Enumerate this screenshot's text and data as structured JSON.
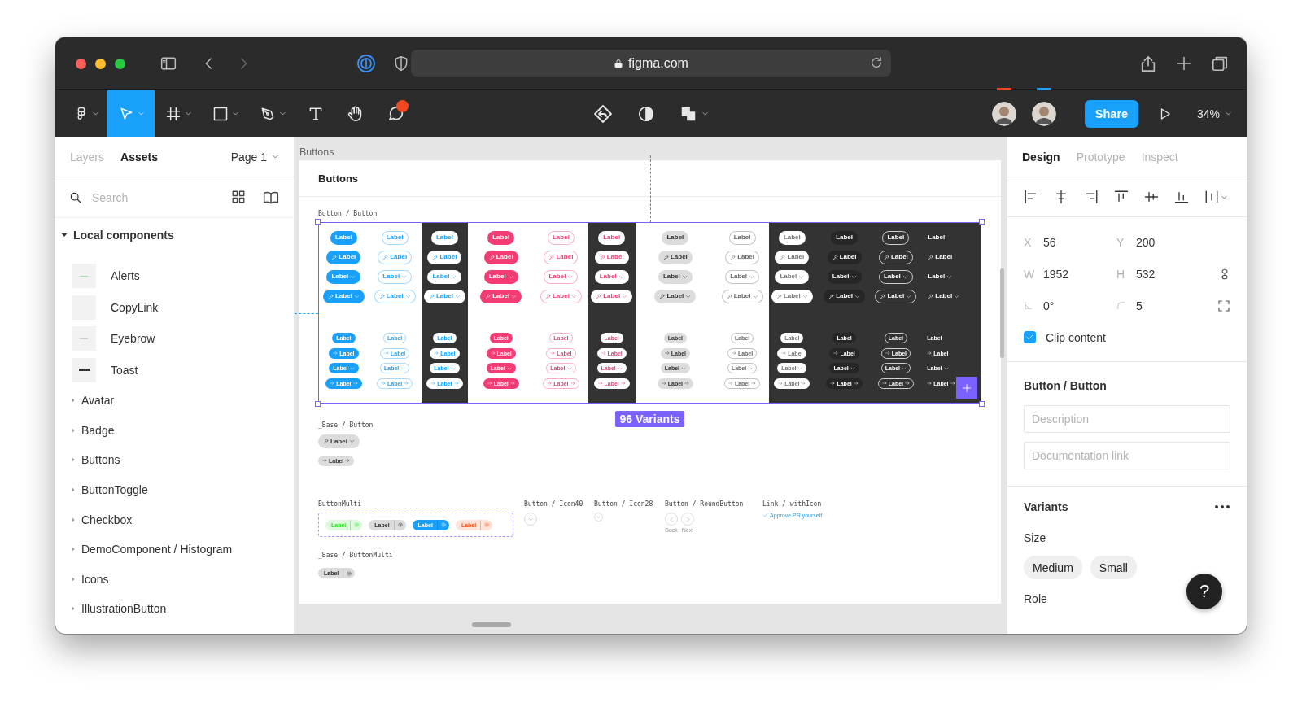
{
  "browser": {
    "url": "figma.com"
  },
  "toolbar": {
    "tools": [
      {
        "kind": "logo",
        "selected": false,
        "notification": false
      },
      {
        "kind": "move",
        "selected": true,
        "notification": false
      },
      {
        "kind": "frame",
        "selected": false,
        "notification": false
      },
      {
        "kind": "shape",
        "selected": false,
        "notification": false
      },
      {
        "kind": "pen",
        "selected": false,
        "notification": false
      },
      {
        "kind": "text",
        "selected": false,
        "notification": false
      },
      {
        "kind": "hand",
        "selected": false,
        "notification": false
      },
      {
        "kind": "comment",
        "selected": false,
        "notification": true
      }
    ],
    "collaborators": [
      {
        "color": "#f24822"
      },
      {
        "color": "#18a0fb"
      }
    ],
    "share": "Share",
    "zoom": "34%"
  },
  "left_panel": {
    "tabs": [
      {
        "label": "Layers",
        "selected": false
      },
      {
        "label": "Assets",
        "selected": true
      }
    ],
    "page": "Page 1",
    "search": {
      "placeholder": "Search"
    },
    "section": {
      "title": "Local components",
      "expanded": true
    },
    "components": [
      {
        "name": "Alerts",
        "kind": "alert"
      },
      {
        "name": "CopyLink",
        "kind": "blank"
      },
      {
        "name": "Eyebrow",
        "kind": "rule"
      },
      {
        "name": "Toast",
        "kind": "bar"
      }
    ],
    "groups": [
      {
        "name": "Avatar",
        "expanded": false
      },
      {
        "name": "Badge",
        "expanded": false
      },
      {
        "name": "Buttons",
        "expanded": false
      },
      {
        "name": "ButtonToggle",
        "expanded": false
      },
      {
        "name": "Checkbox",
        "expanded": false
      },
      {
        "name": "DemoComponent / Histogram",
        "expanded": false
      },
      {
        "name": "Icons",
        "expanded": false
      },
      {
        "name": "IllustrationButton",
        "expanded": false
      }
    ]
  },
  "canvas": {
    "frame_label": "Buttons",
    "frame_title": "Buttons",
    "variant_set": {
      "label": "Button / Button",
      "count": "96 Variants",
      "columns": [
        {
          "kind": "filled",
          "color": "#18a0fb",
          "labels": [
            "Label",
            "Label",
            "Label",
            "Label",
            "Label",
            "Label",
            "Label",
            "Label"
          ]
        },
        {
          "kind": "outline",
          "color": "#18a0fb",
          "labels": [
            "Label",
            "Label",
            "Label",
            "Label",
            "Label",
            "Label",
            "Label",
            "Label"
          ]
        },
        {
          "kind": "inverse",
          "color": "#18a0fb",
          "labels": [
            "Label",
            "Label",
            "Label",
            "Label",
            "Label",
            "Label",
            "Label",
            "Label"
          ]
        },
        {
          "kind": "filled",
          "color": "#f23c73",
          "labels": [
            "Label",
            "Label",
            "Label",
            "Label",
            "Label",
            "Label",
            "Label",
            "Label"
          ]
        },
        {
          "kind": "outline",
          "color": "#f23c73",
          "labels": [
            "Label",
            "Label",
            "Label",
            "Label",
            "Label",
            "Label",
            "Label",
            "Label"
          ]
        },
        {
          "kind": "inverse",
          "color": "#f23c73",
          "labels": [
            "Label",
            "Label",
            "Label",
            "Label",
            "Label",
            "Label",
            "Label",
            "Label"
          ]
        },
        {
          "kind": "filled",
          "color": "#dcdcdc",
          "labels": [
            "Label",
            "Label",
            "Label",
            "Label",
            "Label",
            "Label",
            "Label",
            "Label"
          ]
        },
        {
          "kind": "outline",
          "color": "#666666",
          "labels": [
            "Label",
            "Label",
            "Label",
            "Label",
            "Label",
            "Label",
            "Label",
            "Label"
          ]
        },
        {
          "kind": "inverse",
          "color": "#777777",
          "labels": [
            "Label",
            "Label",
            "Label",
            "Label",
            "Label",
            "Label",
            "Label",
            "Label"
          ]
        },
        {
          "kind": "subtle",
          "color": "#ffffff",
          "labels": [
            "Label",
            "Label",
            "Label",
            "Label",
            "Label",
            "Label",
            "Label",
            "Label"
          ]
        },
        {
          "kind": "outlined",
          "color": "#ffffff",
          "labels": [
            "Label",
            "Label",
            "Label",
            "Label",
            "Label",
            "Label",
            "Label",
            "Label"
          ]
        },
        {
          "kind": "text",
          "color": "#ffffff",
          "labels": [
            "Label",
            "Label",
            "Label",
            "Label",
            "Label",
            "Label",
            "Label",
            "Label"
          ]
        }
      ]
    },
    "base_button": {
      "label": "_Base / Button",
      "buttons": [
        {
          "label": "Label"
        },
        {
          "label": "Label"
        }
      ]
    },
    "button_multi": {
      "label": "ButtonMulti",
      "buttons": [
        {
          "color": "#dcfadb",
          "label": "Label"
        },
        {
          "color": "#dcdcdc",
          "label": "Label"
        },
        {
          "color": "#18a0fb",
          "label": "Label"
        },
        {
          "color": "#ffe2d8",
          "label": "Label"
        }
      ]
    },
    "icon40": {
      "label": "Button / Icon40"
    },
    "icon28": {
      "label": "Button / Icon28"
    },
    "round_button": {
      "label": "Button / RoundButton",
      "buttons": [
        {
          "kind": "back",
          "caption": "Back"
        },
        {
          "kind": "next",
          "caption": "Next"
        }
      ]
    },
    "link": {
      "label": "Link / withIcon",
      "text": "Approve PR yourself"
    },
    "base_multi": {
      "label": "_Base / ButtonMulti",
      "button": {
        "color": "#dcdcdc",
        "label": "Label"
      }
    }
  },
  "design_panel": {
    "tabs": [
      {
        "label": "Design",
        "selected": true
      },
      {
        "label": "Prototype",
        "selected": false
      },
      {
        "label": "Inspect",
        "selected": false
      }
    ],
    "geometry": [
      {
        "kind": "text",
        "label": "X",
        "value": "56"
      },
      {
        "kind": "text",
        "label": "Y",
        "value": "200"
      },
      {
        "kind": "text",
        "label": "W",
        "value": "1952"
      },
      {
        "kind": "text",
        "label": "H",
        "value": "532"
      },
      {
        "kind": "rotation",
        "value": "0°"
      },
      {
        "kind": "radius",
        "value": "5"
      }
    ],
    "clip": {
      "label": "Clip content",
      "checked": true
    },
    "component": {
      "name": "Button / Button",
      "description": {
        "placeholder": "Description"
      },
      "documentation": {
        "placeholder": "Documentation link"
      }
    },
    "variants": {
      "title": "Variants",
      "properties": [
        {
          "name": "Size",
          "options": [
            {
              "label": "Medium"
            },
            {
              "label": "Small"
            }
          ]
        },
        {
          "name": "Role"
        }
      ]
    },
    "help": "?"
  }
}
